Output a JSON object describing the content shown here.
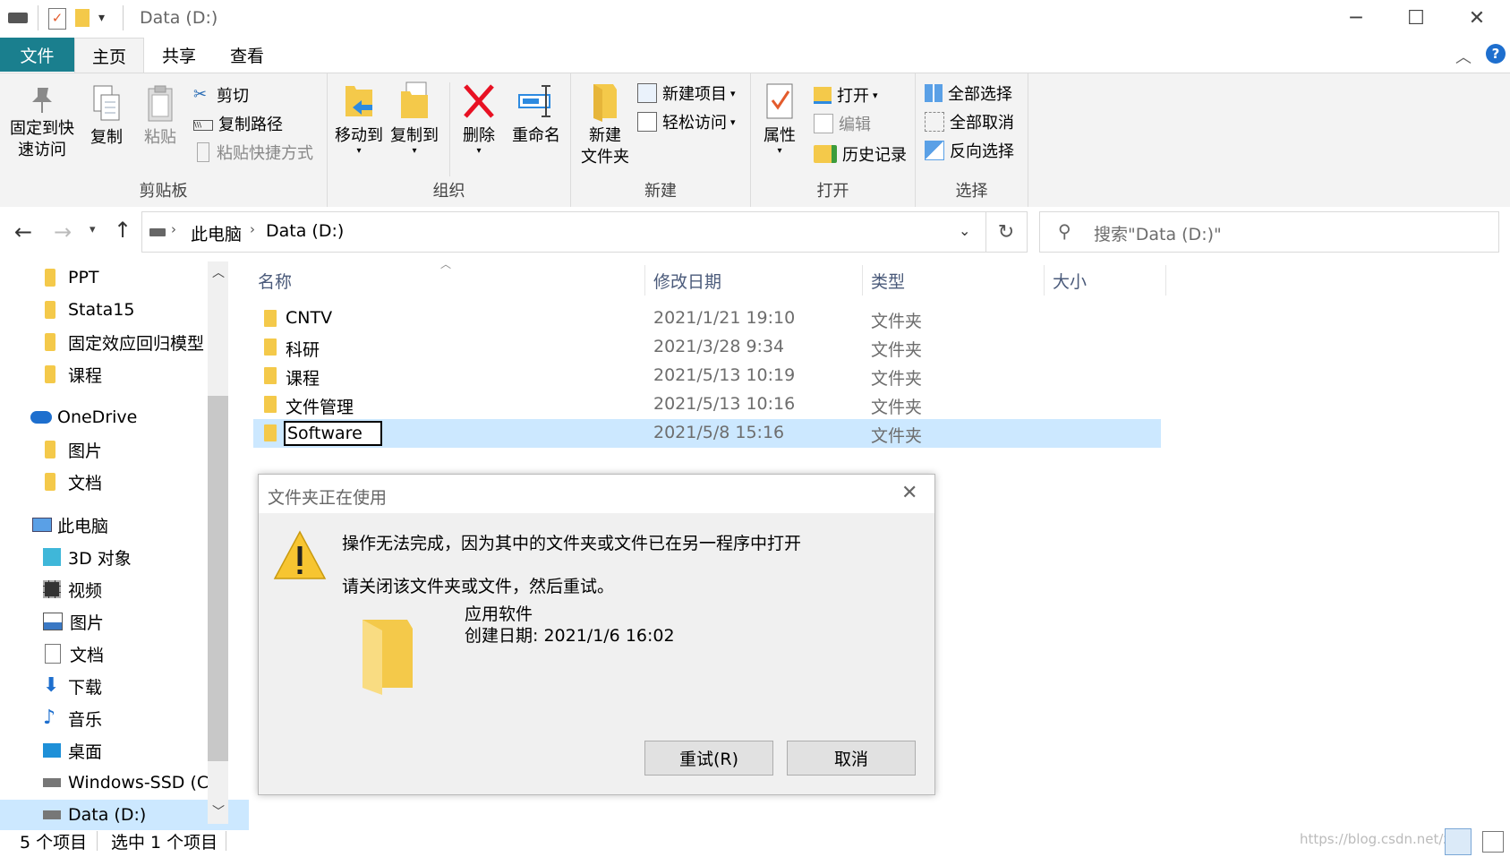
{
  "window": {
    "title": "Data (D:)",
    "minimize": "─",
    "maximize": "☐",
    "close": "✕"
  },
  "tabs": [
    "文件",
    "主页",
    "共享",
    "查看"
  ],
  "ribbon": {
    "clipboard": {
      "pin": "固定到快\n速访问",
      "pin_line1": "固定到快",
      "pin_line2": "速访问",
      "copy": "复制",
      "paste": "粘贴",
      "cut": "剪切",
      "copy_path": "复制路径",
      "paste_shortcut": "粘贴快捷方式",
      "label": "剪贴板"
    },
    "organize": {
      "move_to": "移动到",
      "copy_to": "复制到",
      "delete": "删除",
      "rename": "重命名",
      "label": "组织"
    },
    "new": {
      "new_folder_line1": "新建",
      "new_folder_line2": "文件夹",
      "new_item": "新建项目",
      "easy_access": "轻松访问",
      "label": "新建"
    },
    "open": {
      "properties": "属性",
      "open": "打开",
      "edit": "编辑",
      "history": "历史记录",
      "label": "打开"
    },
    "select": {
      "select_all": "全部选择",
      "select_none": "全部取消",
      "invert": "反向选择",
      "label": "选择"
    }
  },
  "address": {
    "crumbs": [
      "此电脑",
      "Data (D:)"
    ],
    "search_placeholder": "搜索\"Data (D:)\""
  },
  "navpane": {
    "items": [
      {
        "label": "PPT",
        "icon": "folder-icon"
      },
      {
        "label": "Stata15",
        "icon": "folder-icon"
      },
      {
        "label": "固定效应回归模型",
        "icon": "folder-icon"
      },
      {
        "label": "课程",
        "icon": "folder-icon"
      },
      {
        "label": "OneDrive",
        "icon": "cloud-icon"
      },
      {
        "label": "图片",
        "icon": "folder-icon"
      },
      {
        "label": "文档",
        "icon": "folder-icon"
      },
      {
        "label": "此电脑",
        "icon": "computer-icon"
      },
      {
        "label": "3D 对象",
        "icon": "cube-icon"
      },
      {
        "label": "视频",
        "icon": "video-icon"
      },
      {
        "label": "图片",
        "icon": "picture-icon"
      },
      {
        "label": "文档",
        "icon": "document-icon"
      },
      {
        "label": "下载",
        "icon": "download-icon"
      },
      {
        "label": "音乐",
        "icon": "music-icon"
      },
      {
        "label": "桌面",
        "icon": "desktop-icon"
      },
      {
        "label": "Windows-SSD (C:)",
        "icon": "drive-icon"
      },
      {
        "label": "Data (D:)",
        "icon": "drive-icon"
      }
    ]
  },
  "filelist": {
    "columns": [
      "名称",
      "修改日期",
      "类型",
      "大小"
    ],
    "rows": [
      {
        "name": "CNTV",
        "date": "2021/1/21 19:10",
        "type": "文件夹"
      },
      {
        "name": "科研",
        "date": "2021/3/28 9:34",
        "type": "文件夹"
      },
      {
        "name": "课程",
        "date": "2021/5/13 10:19",
        "type": "文件夹"
      },
      {
        "name": "文件管理",
        "date": "2021/5/13 10:16",
        "type": "文件夹"
      },
      {
        "name": "Software",
        "date": "2021/5/8 15:16",
        "type": "文件夹",
        "selected": true
      }
    ]
  },
  "status": {
    "count": "5 个项目",
    "selected": "选中 1 个项目",
    "watermark": "https://blog.csdn.net/zi"
  },
  "dialog": {
    "title": "文件夹正在使用",
    "message": "操作无法完成，因为其中的文件夹或文件已在另一程序中打开",
    "instruction": "请关闭该文件夹或文件，然后重试。",
    "item_name": "应用软件",
    "item_created": "创建日期: 2021/1/6 16:02",
    "retry": "重试(R)",
    "cancel": "取消"
  },
  "colors": {
    "file_tab": "#1a7f8e",
    "selection": "#cce8ff",
    "folder": "#f4c94a",
    "delete_red": "#e81123",
    "warning": "#f7c531"
  }
}
